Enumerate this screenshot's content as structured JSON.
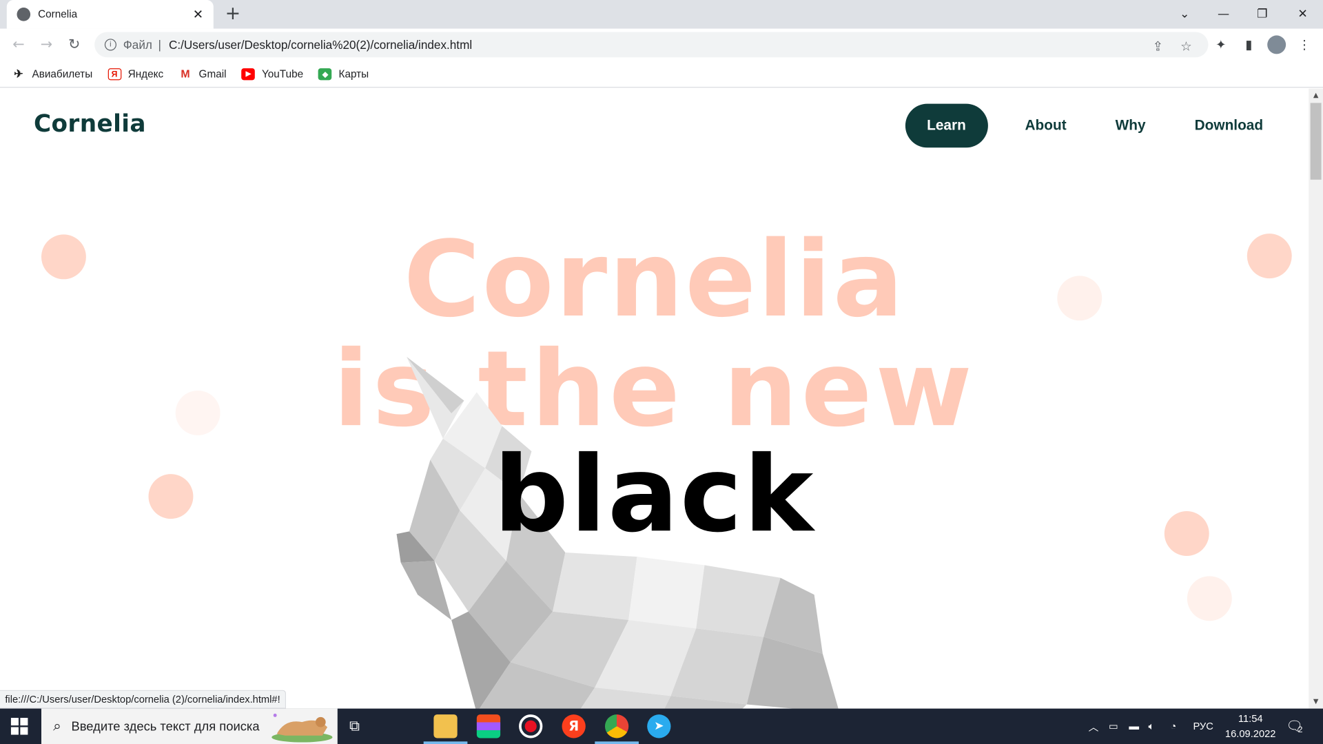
{
  "browser": {
    "tab_title": "Cornelia",
    "url_scheme": "Файл",
    "url": "C:/Users/user/Desktop/cornelia%20(2)/cornelia/index.html",
    "status_url": "file:///C:/Users/user/Desktop/cornelia (2)/cornelia/index.html#!",
    "bookmarks": [
      {
        "label": "Авиабилеты",
        "icon": "plane-icon"
      },
      {
        "label": "Яндекс",
        "icon": "yandex-icon"
      },
      {
        "label": "Gmail",
        "icon": "gmail-icon"
      },
      {
        "label": "YouTube",
        "icon": "youtube-icon"
      },
      {
        "label": "Карты",
        "icon": "maps-icon"
      }
    ]
  },
  "site": {
    "logo": "Cornelia",
    "nav": [
      {
        "label": "Learn",
        "active": true
      },
      {
        "label": "About",
        "active": false
      },
      {
        "label": "Why",
        "active": false
      },
      {
        "label": "Download",
        "active": false
      }
    ],
    "hero": {
      "line1": "Cornelia",
      "line2": "is the new",
      "line3": "black"
    },
    "colors": {
      "brand": "#0f3b3a",
      "hero_peach": "#ffcab8",
      "dot": "#ffd6c8"
    }
  },
  "taskbar": {
    "search_placeholder": "Введите здесь текст для поиска",
    "language": "РУС",
    "time": "11:54",
    "date": "16.09.2022",
    "notifications": "2"
  }
}
